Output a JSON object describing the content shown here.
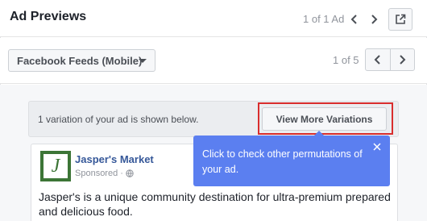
{
  "header": {
    "title": "Ad Previews",
    "ad_count": "1 of 1 Ad",
    "prev_icon": "chevron-left-icon",
    "next_icon": "chevron-right-icon",
    "open_icon": "external-link-icon"
  },
  "placement": {
    "selected": "Facebook Feeds (Mobile)",
    "page_count": "1 of 5"
  },
  "notice": {
    "text": "1 variation of your ad is shown below.",
    "button_label": "View More Variations",
    "highlight_color": "#d92d2d"
  },
  "tooltip": {
    "text": "Click to check other permutations of your ad.",
    "background": "#5b7ff0",
    "close_icon": "close-icon"
  },
  "ad": {
    "page_name": "Jasper's Market",
    "logo_letter": "J",
    "sponsored": "Sponsored",
    "privacy_icon": "globe-icon",
    "body_text": "Jasper's is a unique community destination for ultra-premium prepared and delicious food.",
    "brand_color": "#3c7536",
    "link_color": "#365899"
  }
}
